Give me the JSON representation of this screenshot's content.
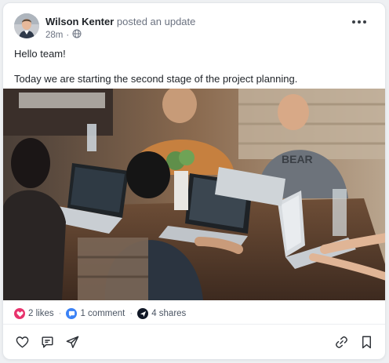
{
  "post": {
    "author": "Wilson Kenter",
    "action": "posted an update",
    "time": "28m",
    "visibility_icon": "globe-icon",
    "paragraphs": [
      "Hello team!",
      "Today we are starting the second stage of the project planning."
    ]
  },
  "stats": {
    "likes": "2 likes",
    "comments": "1 comment",
    "shares": "4 shares",
    "like_color": "#e8336d",
    "comment_color": "#3b82f6",
    "share_color": "#111827"
  },
  "icons": {
    "more": "more-horizontal-icon",
    "like": "heart-icon",
    "comment": "comment-icon",
    "share": "send-icon",
    "link": "link-icon",
    "bookmark": "bookmark-icon"
  }
}
